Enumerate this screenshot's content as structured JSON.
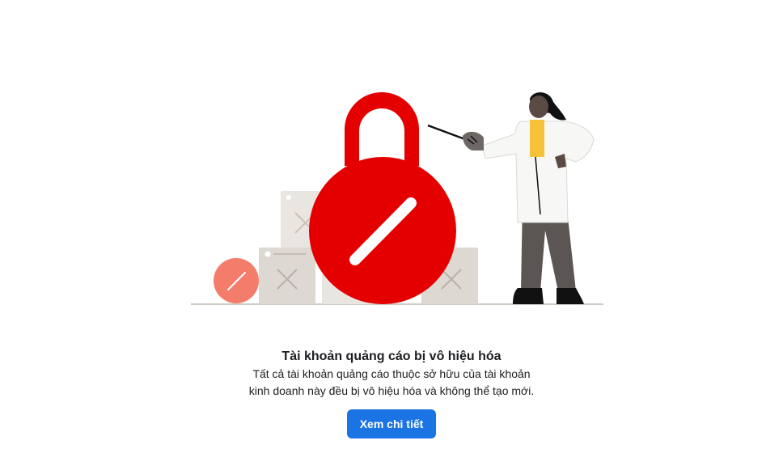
{
  "notice": {
    "title": "Tài khoản quảng cáo bị vô hiệu hóa",
    "description_line1": "Tất cả tài khoản quảng cáo thuộc sở hữu của tài khoản",
    "description_line2": "kinh doanh này đều bị vô hiệu hóa và không thể tạo mới.",
    "button_label": "Xem chi tiết"
  },
  "colors": {
    "accent": "#1b74e4",
    "lock_red": "#e50000",
    "small_badge": "#f47c6b",
    "box_gray": "#ddd8d2"
  },
  "illustration": {
    "icons": [
      "padlock-icon",
      "disabled-badge-icon",
      "woman-pointing-figure"
    ]
  }
}
